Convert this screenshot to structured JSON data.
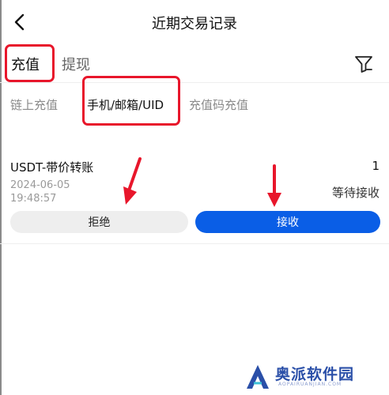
{
  "header": {
    "title": "近期交易记录",
    "back_icon": "chevron-left-icon"
  },
  "tabs": {
    "active": "充值",
    "other": "提现",
    "filter_icon": "filter-icon"
  },
  "subtabs": {
    "onchain": "链上充值",
    "phone_email_uid": "手机/邮箱/UID",
    "code": "充值码充值",
    "active": "手机/邮箱/UID"
  },
  "record": {
    "title": "USDT-带价转账",
    "amount": "1",
    "date": "2024-06-05",
    "time": "19:48:57",
    "status": "等待接收",
    "reject_label": "拒绝",
    "accept_label": "接收"
  },
  "watermark": {
    "text": "奥派软件园",
    "sub": "AOPAIRUANJIAN.COM"
  },
  "colors": {
    "accent": "#0a5ee6",
    "highlight": "#e8162b",
    "arrow": "#e8162b"
  }
}
